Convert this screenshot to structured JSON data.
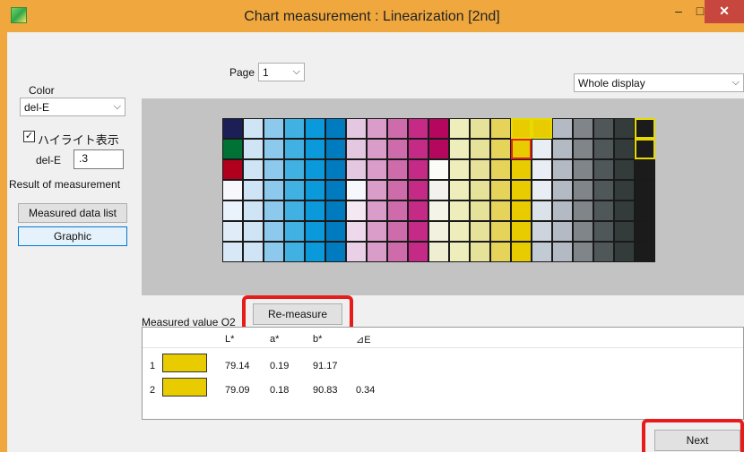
{
  "window": {
    "title": "Chart measurement : Linearization [2nd]",
    "minimize": "–",
    "maximize": "□",
    "close": "✕"
  },
  "page": {
    "label": "Page",
    "value": "1"
  },
  "display_select": {
    "value": "Whole display"
  },
  "left_panel": {
    "color_label": "Color",
    "color_value": "del-E",
    "highlight_label": "ハイライト表示",
    "highlight_checked": true,
    "dele_label": "del-E",
    "dele_value": ".3",
    "result_label": "Result of measurement",
    "measured_list_button": "Measured data list",
    "graphic_button": "Graphic"
  },
  "chart": {
    "columns": 21,
    "rows": 7,
    "cells": [
      [
        "#1c1f55",
        "#cfe4f5",
        "#8dc9ec",
        "#41b1e3",
        "#0a9adb",
        "#007bc0",
        "#e4c7e1",
        "#da9dca",
        "#cd6bab",
        "#c52a86",
        "#b5075d",
        "#eeeebd",
        "#e7e299",
        "#e6d45a",
        "#e8cc00",
        "#e8cc00",
        "#b4bac4",
        "#7f8589",
        "#505758",
        "#343b3b",
        "#1b1b1b"
      ],
      [
        "#007236",
        "#cfe4f5",
        "#8dc9ec",
        "#41b1e3",
        "#0a9adb",
        "#007bc0",
        "#e4c7e1",
        "#da9dca",
        "#cd6bab",
        "#c52a86",
        "#b5075d",
        "#eeeebd",
        "#e7e299",
        "#e6d45a",
        "#e8cc00",
        "#e9edf4",
        "#b4bac4",
        "#7f8589",
        "#505758",
        "#343b3b",
        "#1b1b1b"
      ],
      [
        "#b0001e",
        "#cfe4f5",
        "#8dc9ec",
        "#41b1e3",
        "#0a9adb",
        "#007bc0",
        "#e4c7e1",
        "#da9dca",
        "#cd6bab",
        "#c52a86",
        "#fbfbf8",
        "#eeeebd",
        "#e7e299",
        "#e6d45a",
        "#e8cc00",
        "#e9edf4",
        "#b4bac4",
        "#7f8589",
        "#505758",
        "#343b3b",
        "#1b1b1b"
      ],
      [
        "#f7f8fc",
        "#cfe4f5",
        "#8dc9ec",
        "#41b1e3",
        "#0a9adb",
        "#007bc0",
        "#f7f8fc",
        "#da9dca",
        "#cd6bab",
        "#c52a86",
        "#f4f2ee",
        "#eeeebd",
        "#e7e299",
        "#e6d45a",
        "#e8cc00",
        "#e9edf4",
        "#b4bac4",
        "#7f8589",
        "#505758",
        "#343b3b",
        "#1b1b1b"
      ],
      [
        "#eaf3fb",
        "#cfe4f5",
        "#8dc9ec",
        "#41b1e3",
        "#0a9adb",
        "#007bc0",
        "#f4e8f3",
        "#da9dca",
        "#cd6bab",
        "#c52a86",
        "#f5f4e9",
        "#eeeebd",
        "#e7e299",
        "#e6d45a",
        "#e8cc00",
        "#dce2ea",
        "#b4bac4",
        "#7f8589",
        "#505758",
        "#343b3b",
        "#1b1b1b"
      ],
      [
        "#e0edf9",
        "#cfe4f5",
        "#8dc9ec",
        "#41b1e3",
        "#0a9adb",
        "#007bc0",
        "#eed9ec",
        "#da9dca",
        "#cd6bab",
        "#c52a86",
        "#f2f0df",
        "#eeeebd",
        "#e7e299",
        "#e6d45a",
        "#e8cc00",
        "#cdd4de",
        "#b4bac4",
        "#7f8589",
        "#505758",
        "#343b3b",
        "#1b1b1b"
      ],
      [
        "#d8e8f7",
        "#cfe4f5",
        "#8dc9ec",
        "#41b1e3",
        "#0a9adb",
        "#007bc0",
        "#e9d0e7",
        "#da9dca",
        "#cd6bab",
        "#c52a86",
        "#f0eed2",
        "#eeeebd",
        "#e7e299",
        "#e6d45a",
        "#e8cc00",
        "#c2cad4",
        "#b4bac4",
        "#7f8589",
        "#505758",
        "#343b3b",
        "#1b1b1b"
      ]
    ],
    "highlight_yellow": [
      [
        0,
        20
      ],
      [
        1,
        20
      ],
      [
        0,
        14
      ],
      [
        0,
        15
      ]
    ],
    "highlight_red": [
      [
        1,
        14
      ]
    ]
  },
  "measured": {
    "label": "Measured value O2",
    "remeasure_button": "Re-measure",
    "headers": [
      "L*",
      "a*",
      "b*",
      "⊿E"
    ],
    "rows": [
      {
        "index": "1",
        "swatch": "#e8cc00",
        "L": "79.14",
        "a": "0.19",
        "b": "91.17",
        "dE": ""
      },
      {
        "index": "2",
        "swatch": "#e8cc00",
        "L": "79.09",
        "a": "0.18",
        "b": "90.83",
        "dE": "0.34"
      }
    ]
  },
  "next_button": "Next"
}
